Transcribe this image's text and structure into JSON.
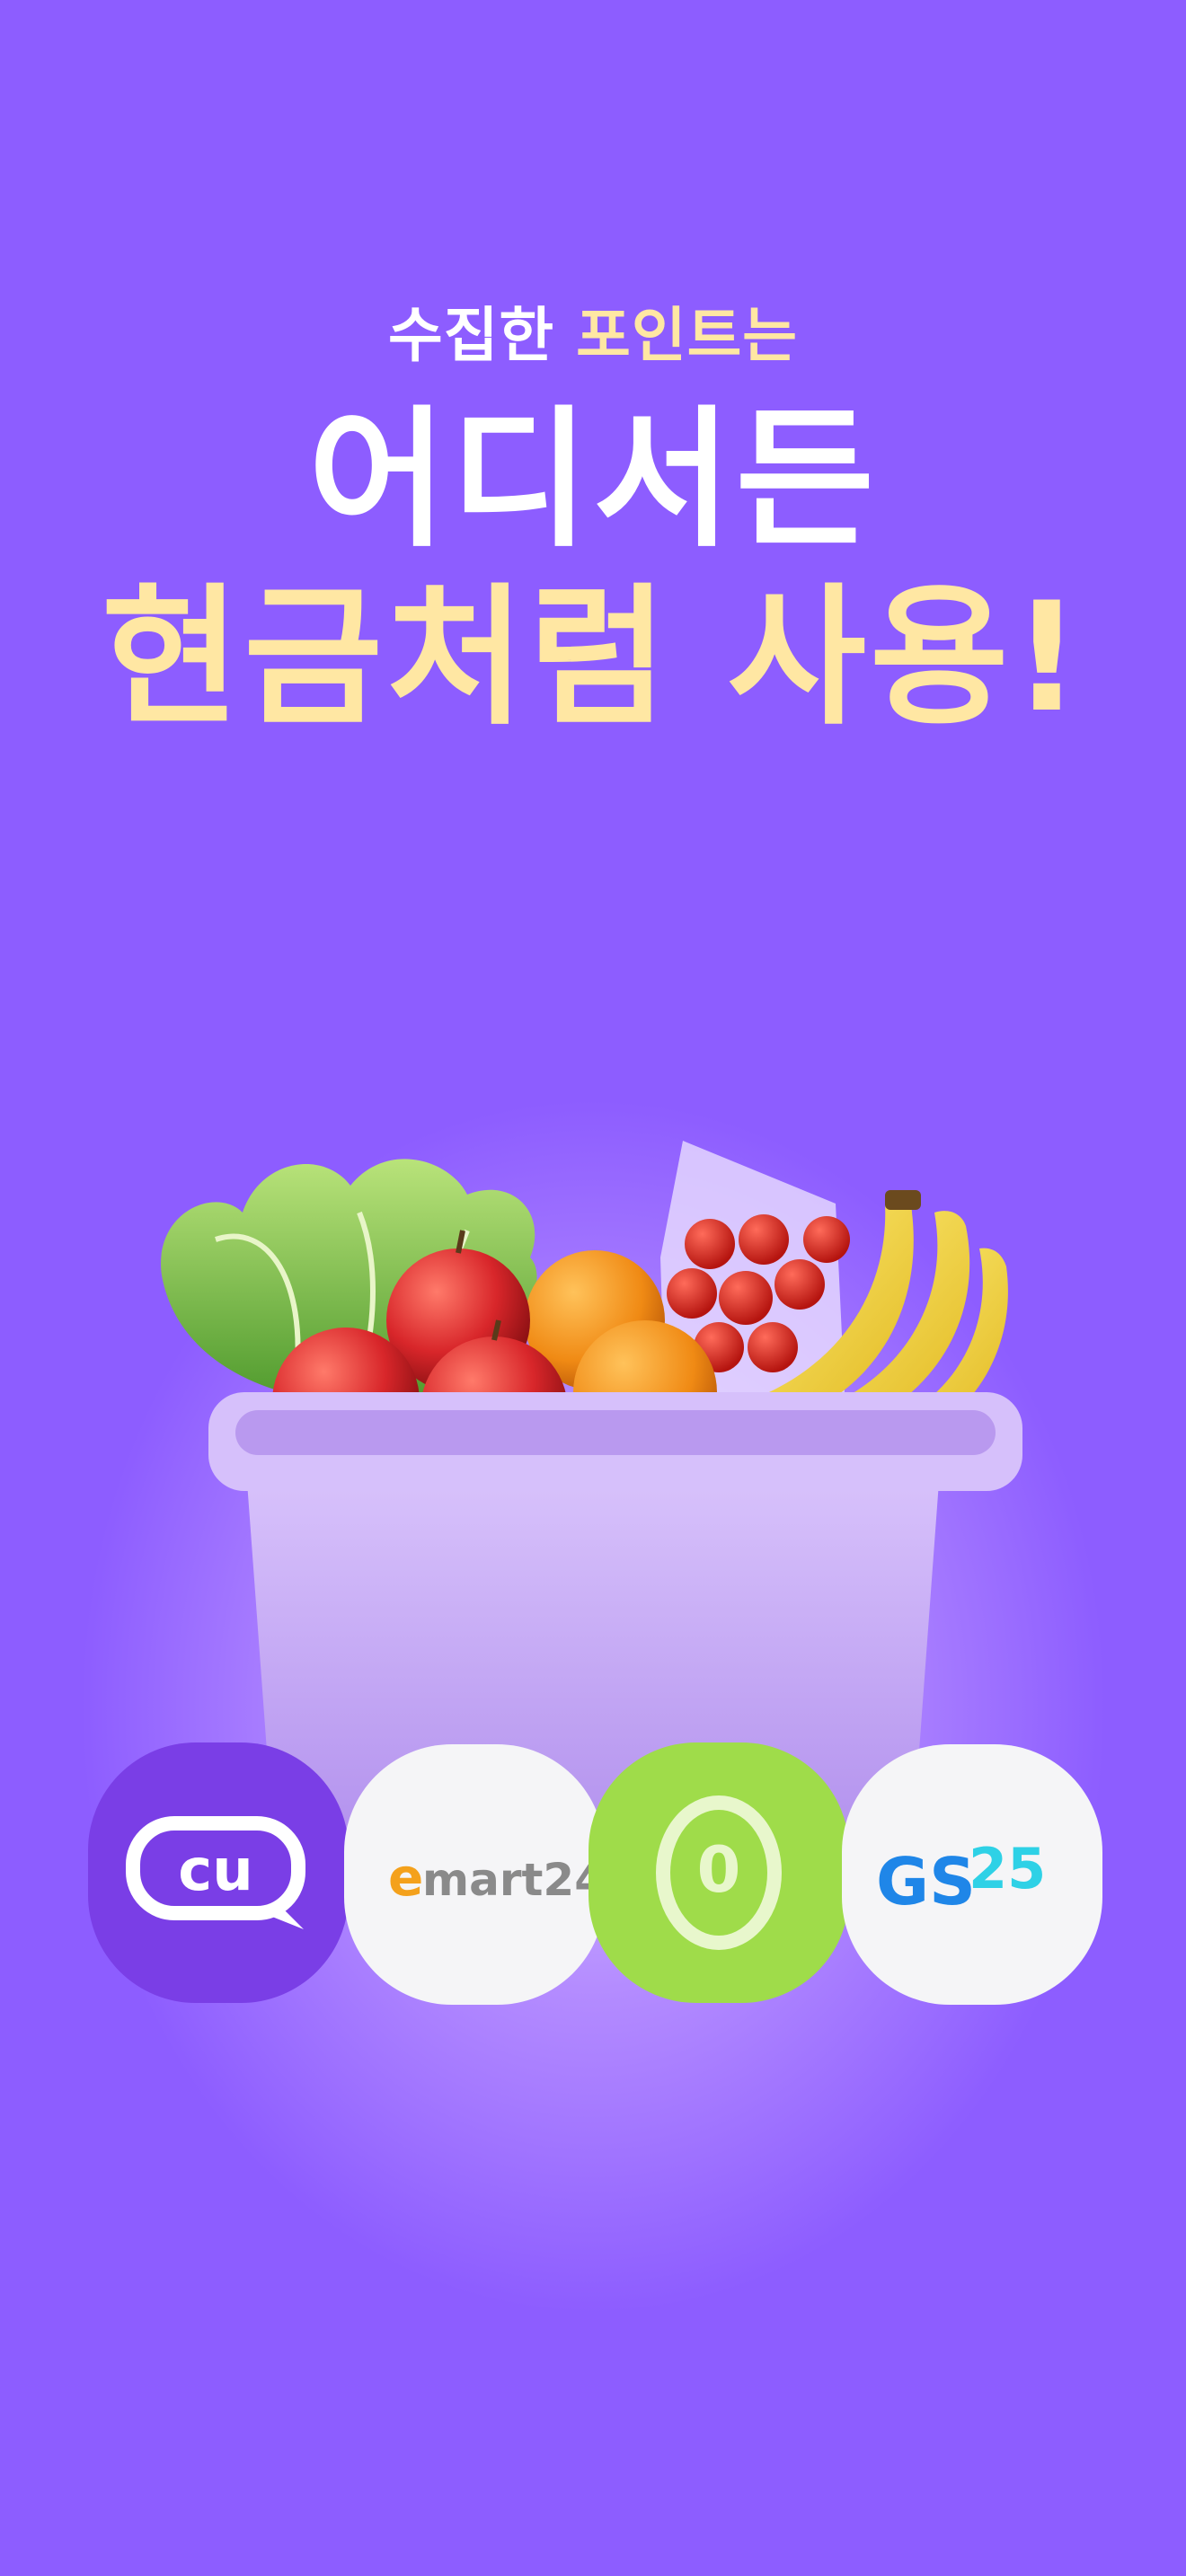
{
  "header": {
    "subtitle_part1": "수집한",
    "subtitle_part2": "포인트는",
    "headline_line1": "어디서든",
    "headline_line2": "현금처럼 사용!"
  },
  "stores": [
    {
      "name": "CU",
      "label": "cu",
      "color": "#7a3ee6"
    },
    {
      "name": "emart24",
      "label_e": "e",
      "label_rest": "mart24",
      "color": "#f5f5f7"
    },
    {
      "name": "olive",
      "label": "0",
      "color": "#9fdc4a"
    },
    {
      "name": "GS25",
      "label_gs": "GS",
      "label_num": "25",
      "color": "#f5f5f7"
    }
  ],
  "colors": {
    "background": "#8d5dff",
    "accent_yellow": "#ffe7a3",
    "basket": "#c6a8f4"
  }
}
